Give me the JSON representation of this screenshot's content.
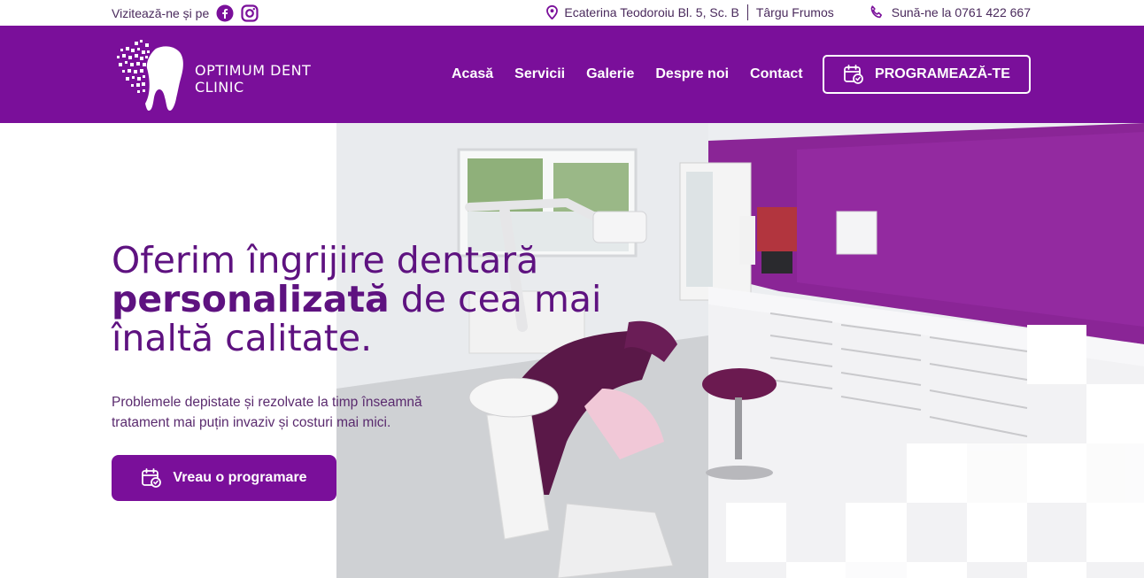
{
  "topbar": {
    "visit_label": "Vizitează-ne și pe",
    "address": "Ecaterina Teodoroiu Bl. 5, Sc. B",
    "city": "Târgu Frumos",
    "phone_label": "Sună-ne la 0761 422 667"
  },
  "header": {
    "logo_line1": "OPTIMUM DENT",
    "logo_line2": "CLINIC",
    "nav": [
      "Acasă",
      "Servicii",
      "Galerie",
      "Despre noi",
      "Contact"
    ],
    "cta": "PROGRAMEAZĂ-TE"
  },
  "hero": {
    "headline_part1": "Oferim îngrijire dentară ",
    "headline_bold": "personalizată",
    "headline_part2": " de cea mai înaltă calitate.",
    "subtext": "Problemele depistate și rezolvate la timp înseamnă tratament mai puțin invaziv și costuri mai mici.",
    "cta": "Vreau o programare"
  },
  "colors": {
    "brand_purple": "#7a0f9a",
    "headline_purple": "#5e1280",
    "wall_purple": "#8a2596"
  },
  "icons": [
    "facebook-icon",
    "instagram-icon",
    "location-pin-icon",
    "phone-icon",
    "calendar-check-icon"
  ]
}
